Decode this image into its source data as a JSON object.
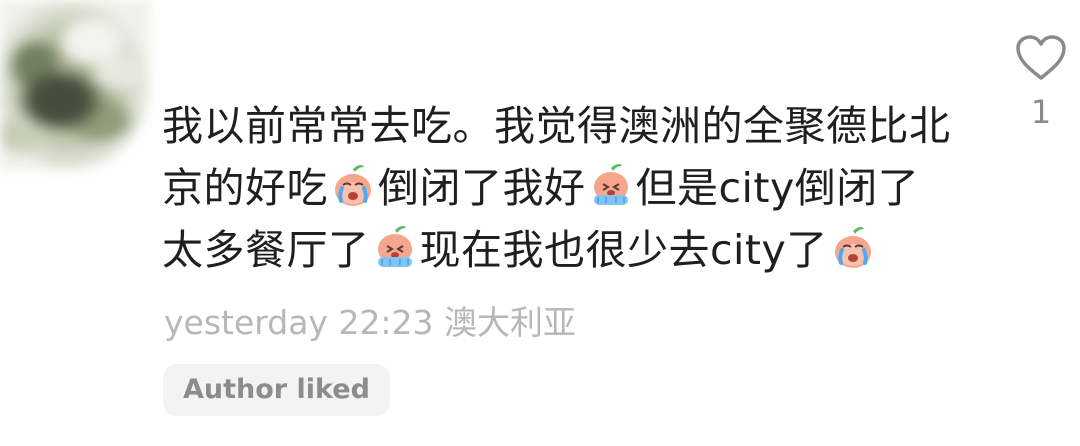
{
  "comment": {
    "line1": "我以前常常去吃。我觉得澳洲的全聚德比北",
    "line2": [
      "京的好吃",
      "倒闭了我好",
      "但是city倒闭了"
    ],
    "line3": [
      "太多餐厅了",
      "现在我也很少去city了"
    ],
    "emojis": [
      "crying-face-emoji",
      "sobbing-face-emoji",
      "sobbing-face-emoji",
      "crying-face-emoji"
    ]
  },
  "meta": {
    "time": "yesterday 22:23",
    "location": "澳大利亚"
  },
  "badge": {
    "author_liked": "Author liked"
  },
  "like": {
    "icon": "heart-icon",
    "count": "1"
  },
  "colors": {
    "text": "#1f1f1f",
    "meta": "#b7b7b7",
    "badge_bg": "#f3f3f3",
    "badge_text": "#8c8c8c",
    "heart": "#8a8a8a"
  }
}
